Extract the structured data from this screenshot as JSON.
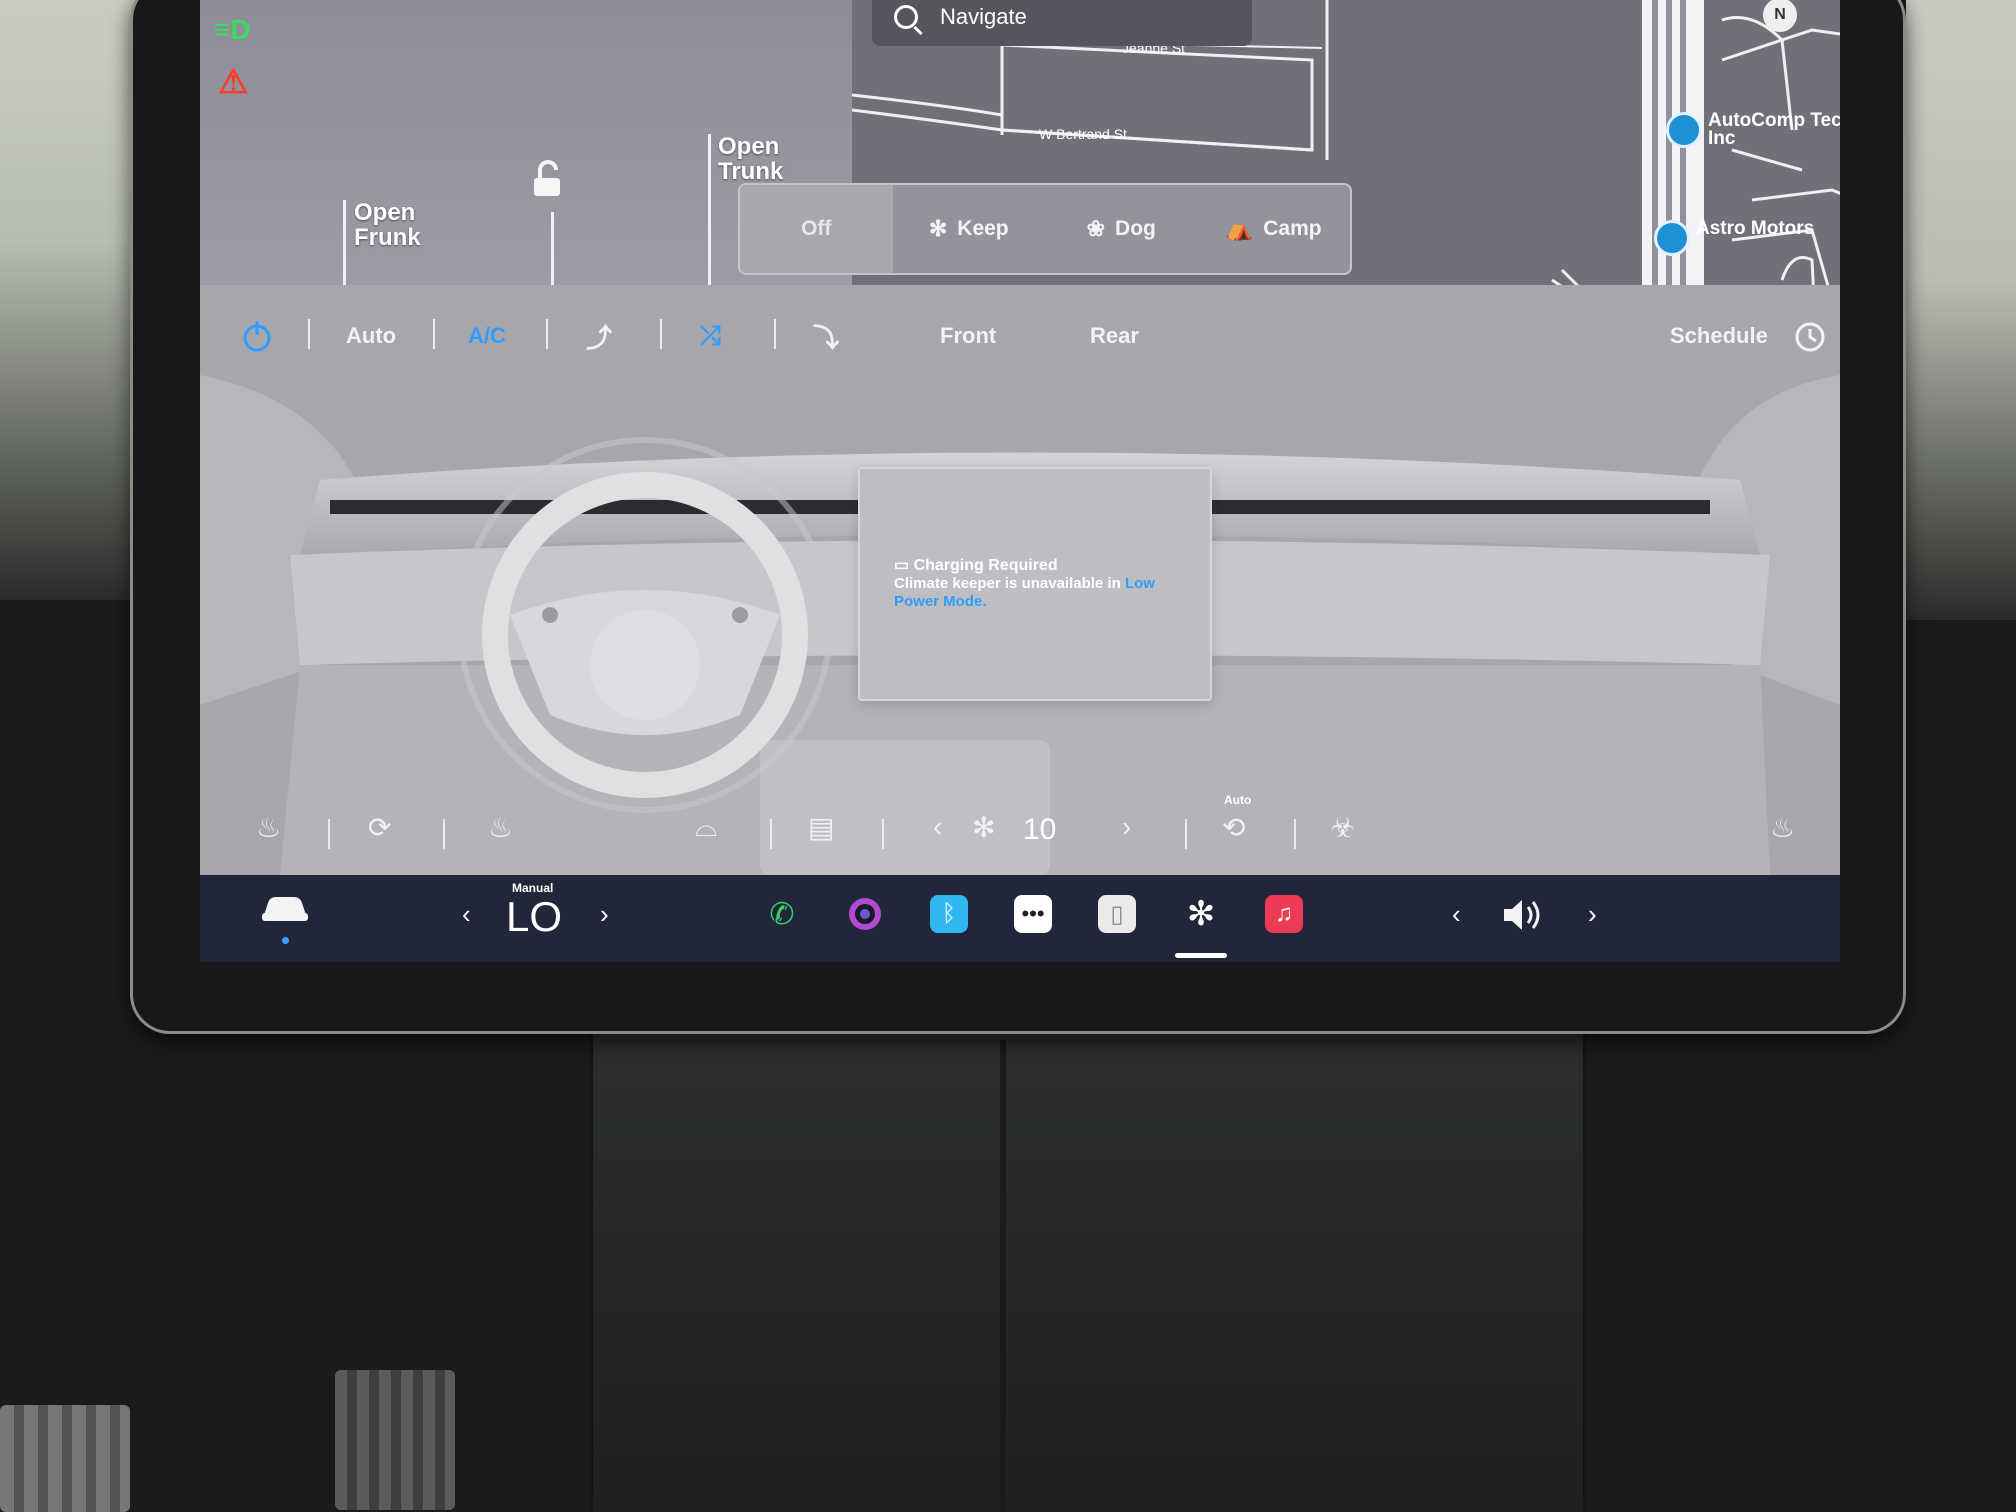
{
  "navigation": {
    "search_placeholder": "Navigate",
    "compass_label": "N"
  },
  "map": {
    "streets": [
      "Jeanne St",
      "W Bertrand St"
    ],
    "pois": [
      {
        "label": "AutoComp Technologies, Inc"
      },
      {
        "label": "Astro Motors"
      }
    ]
  },
  "vehicle": {
    "open_frunk": "Open\nFrunk",
    "open_trunk": "Open\nTrunk",
    "indicators": {
      "headlight": "⩤D",
      "seatbelt": "⚠"
    }
  },
  "climate_keeper": {
    "options": [
      {
        "label": "Off",
        "icon": "",
        "selected": true
      },
      {
        "label": "Keep",
        "icon": "fan-icon"
      },
      {
        "label": "Dog",
        "icon": "paw-icon"
      },
      {
        "label": "Camp",
        "icon": "tent-icon"
      }
    ]
  },
  "climate": {
    "controls": {
      "auto": "Auto",
      "ac": "A/C",
      "front": "Front",
      "rear": "Rear",
      "schedule": "Schedule"
    },
    "message": {
      "title": "Charging Required",
      "body": "Climate keeper is unavailable in ",
      "link": "Low Power Mode."
    },
    "fan_speed": "10",
    "recirc_mode": "Auto",
    "accent_color": "#2e9dff"
  },
  "taskbar": {
    "temp_mode": "Manual",
    "temperature": "LO",
    "prev_arrow": "‹",
    "next_arrow": "›"
  }
}
